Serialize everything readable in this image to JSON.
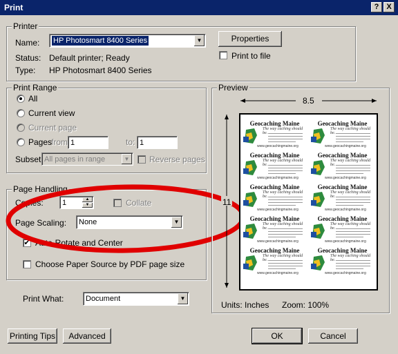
{
  "window": {
    "title": "Print",
    "help_button": "?",
    "close_button": "X"
  },
  "printer": {
    "group_label": "Printer",
    "name_label": "Name:",
    "name_value": "HP Photosmart 8400 Series",
    "status_label": "Status:",
    "status_value": "Default printer; Ready",
    "type_label": "Type:",
    "type_value": "HP Photosmart 8400 Series",
    "properties_button": "Properties",
    "print_to_file_label": "Print to file",
    "print_to_file_checked": false
  },
  "print_range": {
    "group_label": "Print Range",
    "all_label": "All",
    "current_view_label": "Current view",
    "current_page_label": "Current page",
    "pages_label": "Pages",
    "from_label": "from:",
    "from_value": "1",
    "to_label": "to:",
    "to_value": "1",
    "subset_label": "Subset:",
    "subset_value": "All pages in range",
    "reverse_pages_label": "Reverse pages",
    "selected": "All"
  },
  "page_handling": {
    "group_label": "Page Handling",
    "copies_label": "Copies:",
    "copies_value": "1",
    "collate_label": "Collate",
    "page_scaling_label": "Page Scaling:",
    "page_scaling_value": "None",
    "auto_rotate_label": "Auto-Rotate and Center",
    "auto_rotate_checked": true,
    "choose_paper_label": "Choose Paper Source by PDF page size",
    "choose_paper_checked": false,
    "print_what_label": "Print What:",
    "print_what_value": "Document"
  },
  "preview": {
    "group_label": "Preview",
    "width_label": "8.5",
    "height_label": "11",
    "units_label": "Units: Inches",
    "zoom_label": "Zoom: 100%",
    "card_title": "Geocaching Maine",
    "card_tagline": "The way caching should be.",
    "card_url": "www.geocachingmaine.org"
  },
  "buttons": {
    "printing_tips": "Printing Tips",
    "advanced": "Advanced",
    "ok": "OK",
    "cancel": "Cancel"
  },
  "annotation": {
    "color": "#e00000"
  }
}
